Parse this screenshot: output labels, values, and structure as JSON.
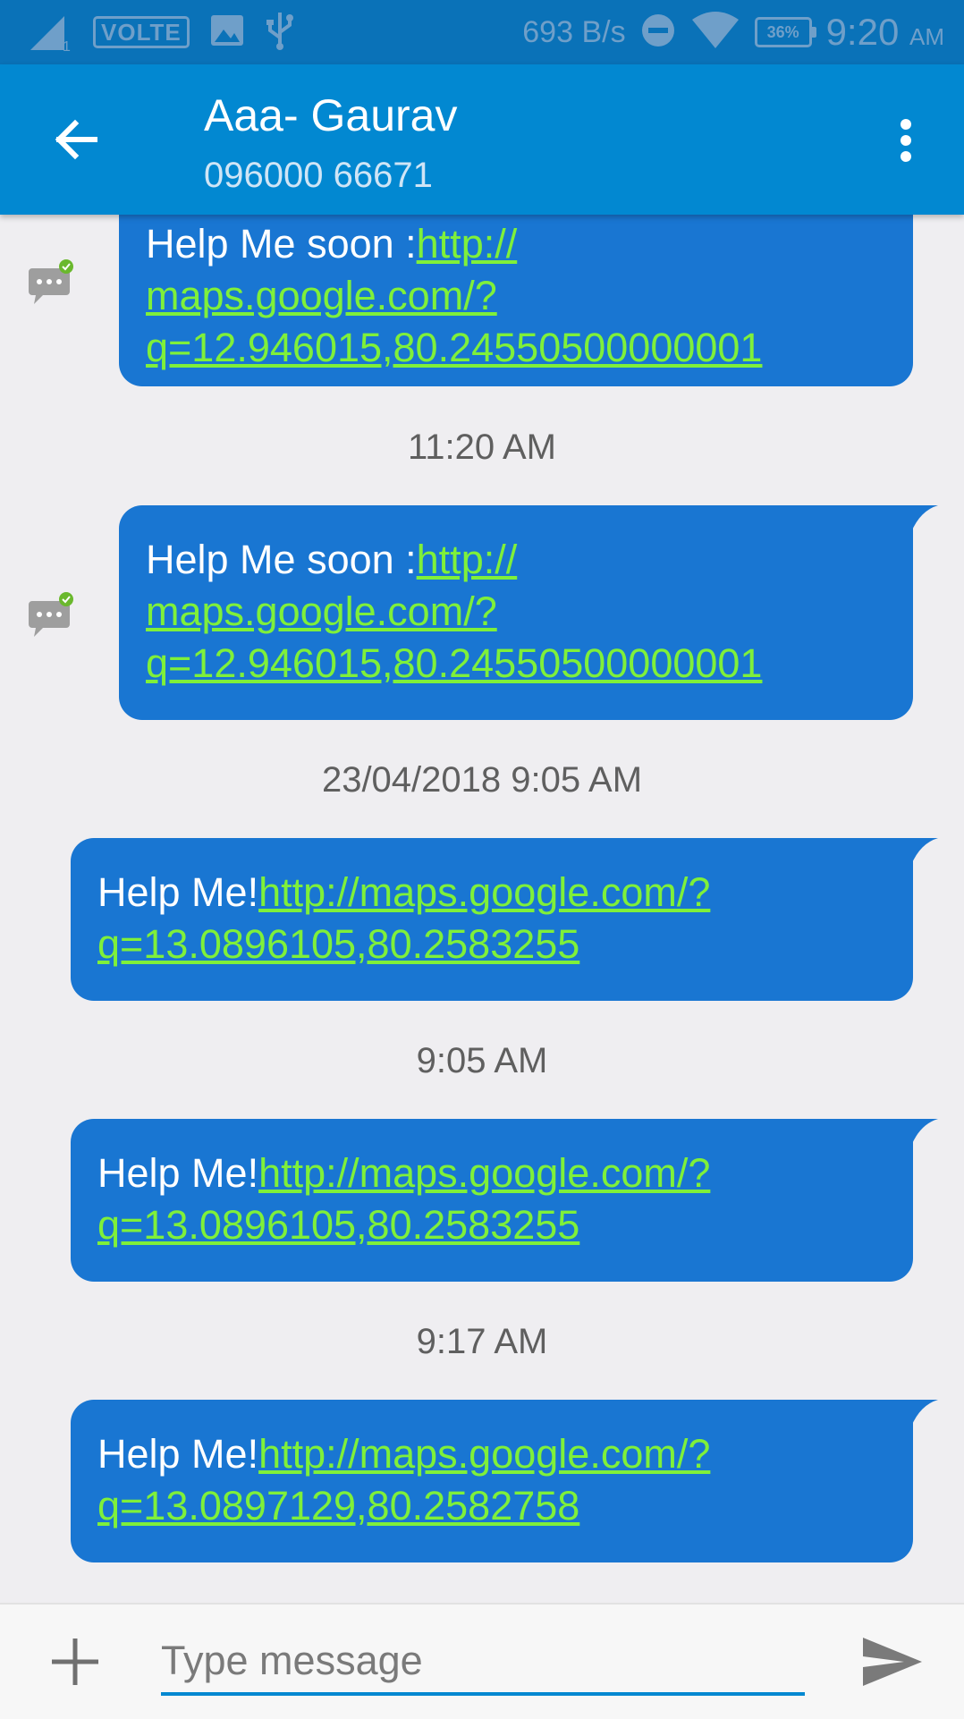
{
  "status_bar": {
    "sim_indicator": "1",
    "volte": "VOLTE",
    "network_speed": "693 B/s",
    "battery": "36%",
    "time": "9:20",
    "ampm": "AM",
    "icons": [
      "signal-icon",
      "image-icon",
      "usb-icon",
      "dnd-icon",
      "wifi-icon",
      "battery-icon"
    ]
  },
  "app_bar": {
    "title": "Aaa- Gaurav",
    "subtitle": "096000 66671",
    "back_icon": "arrow-back-icon",
    "menu_icon": "more-vert-icon"
  },
  "messages": [
    {
      "prefix": "Help Me soon :",
      "link_lines": [
        "http://",
        "maps.google.com/?",
        "q=12.946015,80.24550500000001"
      ],
      "status": "sent-check"
    },
    {
      "prefix": "Help Me soon :",
      "link_lines": [
        "http://",
        "maps.google.com/?",
        "q=12.946015,80.24550500000001"
      ],
      "status": "sent-check"
    },
    {
      "prefix": "Help Me!",
      "link_lines": [
        "http://maps.google.com/?",
        "q=13.0896105,80.2583255"
      ]
    },
    {
      "prefix": "Help Me!",
      "link_lines": [
        "http://maps.google.com/?",
        "q=13.0896105,80.2583255"
      ]
    },
    {
      "prefix": "Help Me!",
      "link_lines": [
        "http://maps.google.com/?",
        "q=13.0897129,80.2582758"
      ]
    }
  ],
  "timestamps": [
    "11:20 AM",
    "23/04/2018 9:05 AM",
    "9:05 AM",
    "9:17 AM"
  ],
  "composer": {
    "placeholder": "Type message",
    "add_icon": "plus-icon",
    "send_icon": "send-icon"
  },
  "colors": {
    "status_bar": "#0a72b8",
    "app_bar": "#0288d1",
    "bubble": "#1976d2",
    "link": "#7ff03a",
    "background": "#efeef1"
  }
}
